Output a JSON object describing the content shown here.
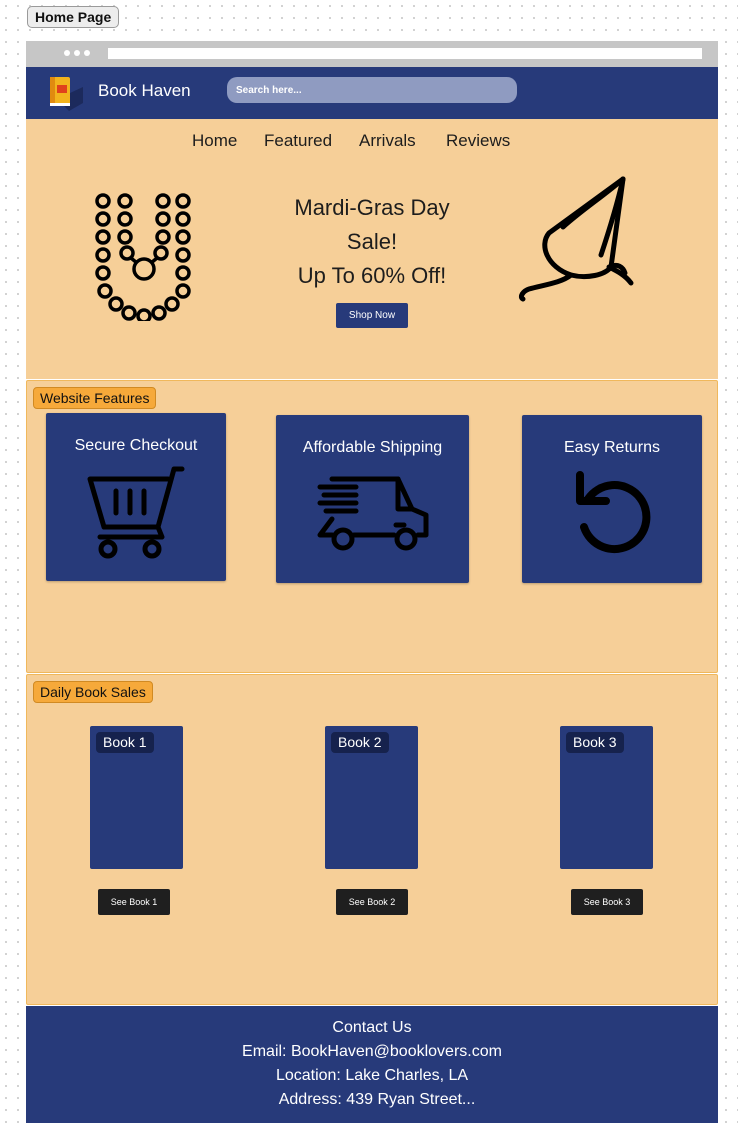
{
  "frame_label": "Home Page",
  "header": {
    "brand": "Book Haven",
    "search_placeholder": "Search here...",
    "logo_icon": "book-logo-icon"
  },
  "nav": [
    "Home",
    "Featured",
    "Arrivals",
    "Reviews"
  ],
  "hero": {
    "line1": "Mardi-Gras Day",
    "line2": "Sale!",
    "line3": "Up To 60% Off!",
    "cta": "Shop Now"
  },
  "features": {
    "title": "Website Features",
    "cards": [
      {
        "title": "Secure Checkout",
        "icon": "shopping-cart-icon"
      },
      {
        "title": "Affordable Shipping",
        "icon": "delivery-truck-icon"
      },
      {
        "title": "Easy Returns",
        "icon": "return-arrow-icon"
      }
    ]
  },
  "sales": {
    "title": "Daily Book Sales",
    "books": [
      {
        "label": "Book 1",
        "button": "See Book 1"
      },
      {
        "label": "Book 2",
        "button": "See Book 2"
      },
      {
        "label": "Book 3",
        "button": "See Book 3"
      }
    ]
  },
  "footer": {
    "heading": "Contact Us",
    "email": "Email: BookHaven@booklovers.com",
    "location": "Location: Lake Charles, LA",
    "address": "Address: 439 Ryan Street..."
  },
  "colors": {
    "navy": "#273a7a",
    "peach": "#f6cf98",
    "tag_orange": "#f6a93a",
    "search": "#8f9bc1"
  }
}
